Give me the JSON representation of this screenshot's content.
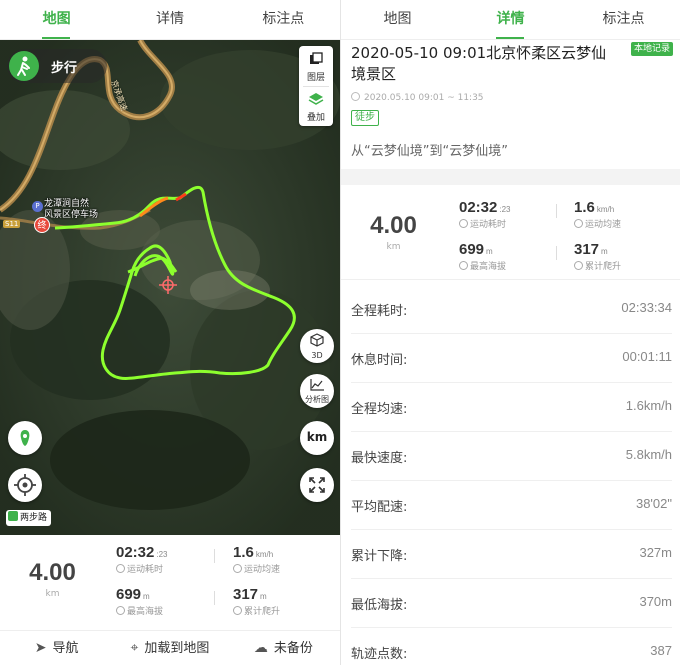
{
  "left": {
    "tabs": [
      {
        "label": "地图",
        "active": true
      },
      {
        "label": "详情",
        "active": false
      },
      {
        "label": "标注点",
        "active": false
      }
    ],
    "map": {
      "mode_label": "步行",
      "layer_btn_label": "图层",
      "overlay_btn_label": "叠加",
      "btn_3d_label": "3D",
      "btn_analysis_label": "分析图",
      "btn_unit_label": "km",
      "poi_name_line1": "龙潭涧自然",
      "poi_name_line2": "风景区停车场",
      "poi_badge": "P",
      "end_marker": "终",
      "road_sign": "S11",
      "road_text": "京承高速",
      "path_badge": "两步路"
    },
    "stats": {
      "distance": "4.00",
      "distance_unit": "km",
      "duration": "02:32",
      "duration_sec": ":23",
      "duration_label": "运动耗时",
      "avg_speed": "1.6",
      "avg_speed_unit": "km/h",
      "avg_speed_label": "运动均速",
      "max_alt": "699",
      "max_alt_unit": "m",
      "max_alt_label": "最高海拔",
      "climb": "317",
      "climb_unit": "m",
      "climb_label": "累计爬升"
    },
    "bottom_bar": [
      {
        "label": "导航",
        "icon": "navigate-icon"
      },
      {
        "label": "加载到地图",
        "icon": "map-pin-icon"
      },
      {
        "label": "未备份",
        "icon": "cloud-upload-icon"
      }
    ]
  },
  "right": {
    "tabs": [
      {
        "label": "地图",
        "active": false
      },
      {
        "label": "详情",
        "active": true
      },
      {
        "label": "标注点",
        "active": false
      }
    ],
    "title": "2020-05-10 09:01北京怀柔区云梦仙境景区",
    "local_badge": "本地记录",
    "time_range": "2020.05.10 09:01 ~ 11:35",
    "tag": "徒步",
    "route_desc": "从“云梦仙境”到“云梦仙境”",
    "stats": {
      "distance": "4.00",
      "distance_unit": "km",
      "duration": "02:32",
      "duration_sec": ":23",
      "duration_label": "运动耗时",
      "avg_speed": "1.6",
      "avg_speed_unit": "km/h",
      "avg_speed_label": "运动均速",
      "max_alt": "699",
      "max_alt_unit": "m",
      "max_alt_label": "最高海拔",
      "climb": "317",
      "climb_unit": "m",
      "climb_label": "累计爬升"
    },
    "details": [
      {
        "label": "全程耗时:",
        "value": "02:33:34"
      },
      {
        "label": "休息时间:",
        "value": "00:01:11"
      },
      {
        "label": "全程均速:",
        "value": "1.6km/h"
      },
      {
        "label": "最快速度:",
        "value": "5.8km/h"
      },
      {
        "label": "平均配速:",
        "value": "38'02\""
      },
      {
        "label": "累计下降:",
        "value": "327m"
      },
      {
        "label": "最低海拔:",
        "value": "370m"
      },
      {
        "label": "轨迹点数:",
        "value": "387"
      }
    ]
  },
  "colors": {
    "accent": "#3fb24b",
    "track": "#8dff2e",
    "end_marker": "#e84a3c"
  }
}
